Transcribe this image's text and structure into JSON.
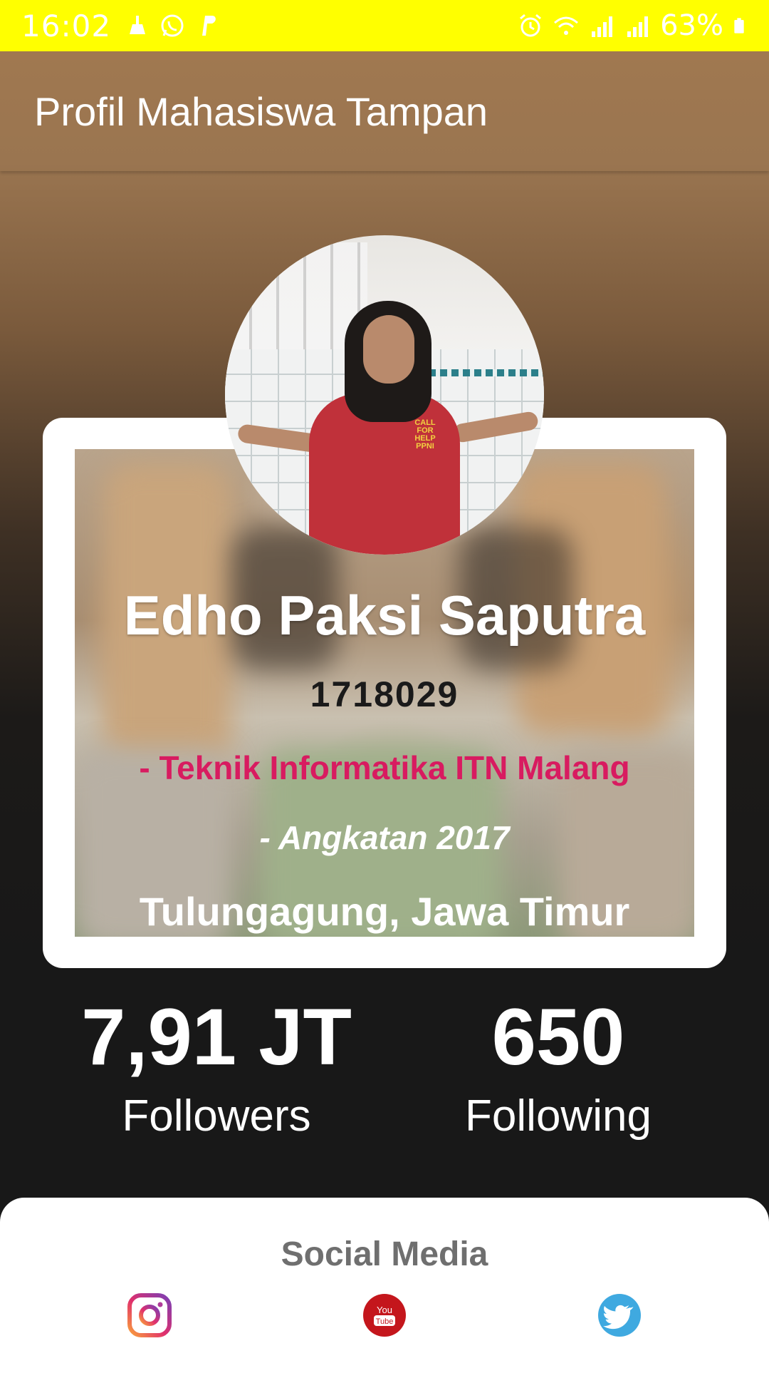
{
  "status_bar": {
    "time": "16:02",
    "battery": "63%",
    "left_icons": [
      "cleaner-icon",
      "whatsapp-icon",
      "paypal-icon"
    ],
    "right_icons": [
      "alarm-icon",
      "wifi-icon",
      "signal-icon",
      "signal-icon",
      "battery-icon"
    ]
  },
  "app_bar": {
    "title": "Profil Mahasiswa Tampan"
  },
  "profile": {
    "name": "Edho Paksi Saputra",
    "student_id": "1718029",
    "department": "- Teknik Informatika ITN Malang",
    "cohort": "- Angkatan 2017",
    "location": "Tulungagung, Jawa Timur"
  },
  "stats": {
    "followers_value": "7,91 JT",
    "followers_label": "Followers",
    "following_value": "650",
    "following_label": "Following"
  },
  "social": {
    "title": "Social Media",
    "items": [
      {
        "name": "instagram",
        "icon": "instagram-icon"
      },
      {
        "name": "youtube",
        "icon": "youtube-icon"
      },
      {
        "name": "twitter",
        "icon": "twitter-icon"
      }
    ]
  },
  "colors": {
    "status_bar": "#ffff00",
    "department_text": "#d81b60",
    "youtube": "#c4161c",
    "twitter": "#3fa9e0"
  }
}
